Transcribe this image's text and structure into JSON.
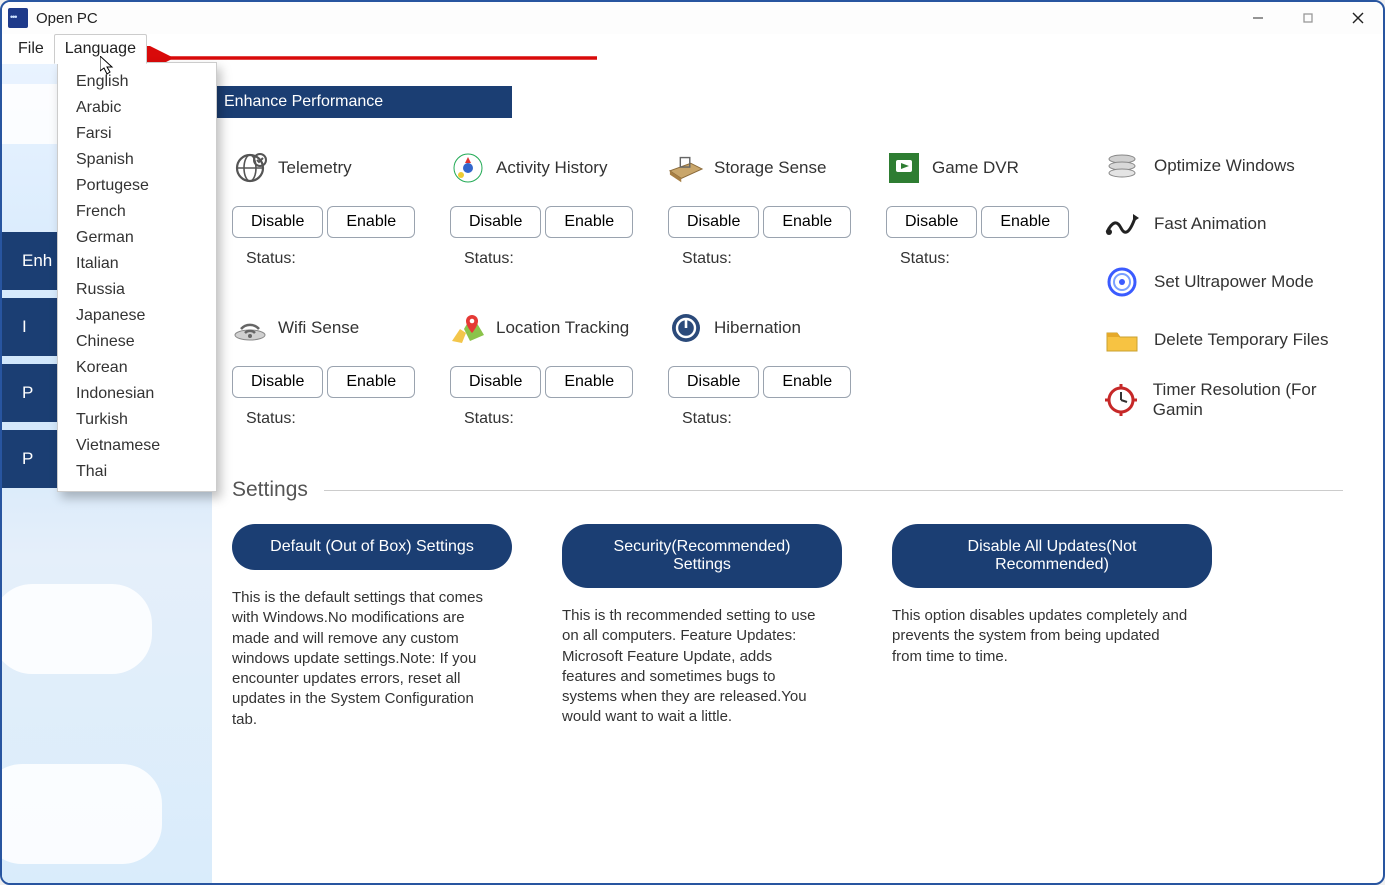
{
  "window": {
    "title": "Open PC"
  },
  "menubar": {
    "file": "File",
    "language": "Language"
  },
  "language_menu": {
    "items": [
      "English",
      "Arabic",
      "Farsi",
      "Spanish",
      "Portugese",
      "French",
      "German",
      "Italian",
      "Russia",
      "Japanese",
      "Chinese",
      "Korean",
      "Indonesian",
      "Turkish",
      "Vietnamese",
      "Thai"
    ]
  },
  "sidebar": {
    "items": [
      "Enh",
      "I",
      "P",
      "P"
    ]
  },
  "header": {
    "title": "Enhance Performance"
  },
  "buttons": {
    "disable": "Disable",
    "enable": "Enable"
  },
  "status_label": "Status:",
  "features_row1": [
    {
      "name": "Telemetry",
      "rowButtons": true
    },
    {
      "name": "Activity History",
      "rowButtons": true
    },
    {
      "name": "Storage Sense",
      "rowButtons": true
    },
    {
      "name": "Game DVR",
      "rowButtons": true
    }
  ],
  "features_row2": [
    {
      "name": "Wifi Sense",
      "rowButtons": true
    },
    {
      "name": "Location Tracking",
      "rowButtons": true
    },
    {
      "name": "Hibernation",
      "rowButtons": true
    }
  ],
  "actions": [
    {
      "label": "Optimize Windows"
    },
    {
      "label": "Fast Animation"
    },
    {
      "label": "Set Ultrapower Mode"
    },
    {
      "label": "Delete Temporary Files"
    },
    {
      "label": "Timer Resolution (For Gamin"
    }
  ],
  "settings": {
    "title": "Settings",
    "cards": [
      {
        "button": "Default (Out of Box) Settings",
        "desc": "This is the default settings that comes with Windows.No modifications are made and will remove any custom windows update settings.Note: If you encounter updates errors, reset all updates in the System Configuration tab."
      },
      {
        "button": "Security(Recommended) Settings",
        "desc": "This is th recommended setting to use on all computers. Feature Updates: Microsoft Feature Update, adds features and sometimes bugs to systems when they are released.You would want to wait a little."
      },
      {
        "button": "Disable All Updates(Not Recommended)",
        "desc": "This option disables updates completely and prevents the system from being updated from time to time."
      }
    ]
  }
}
